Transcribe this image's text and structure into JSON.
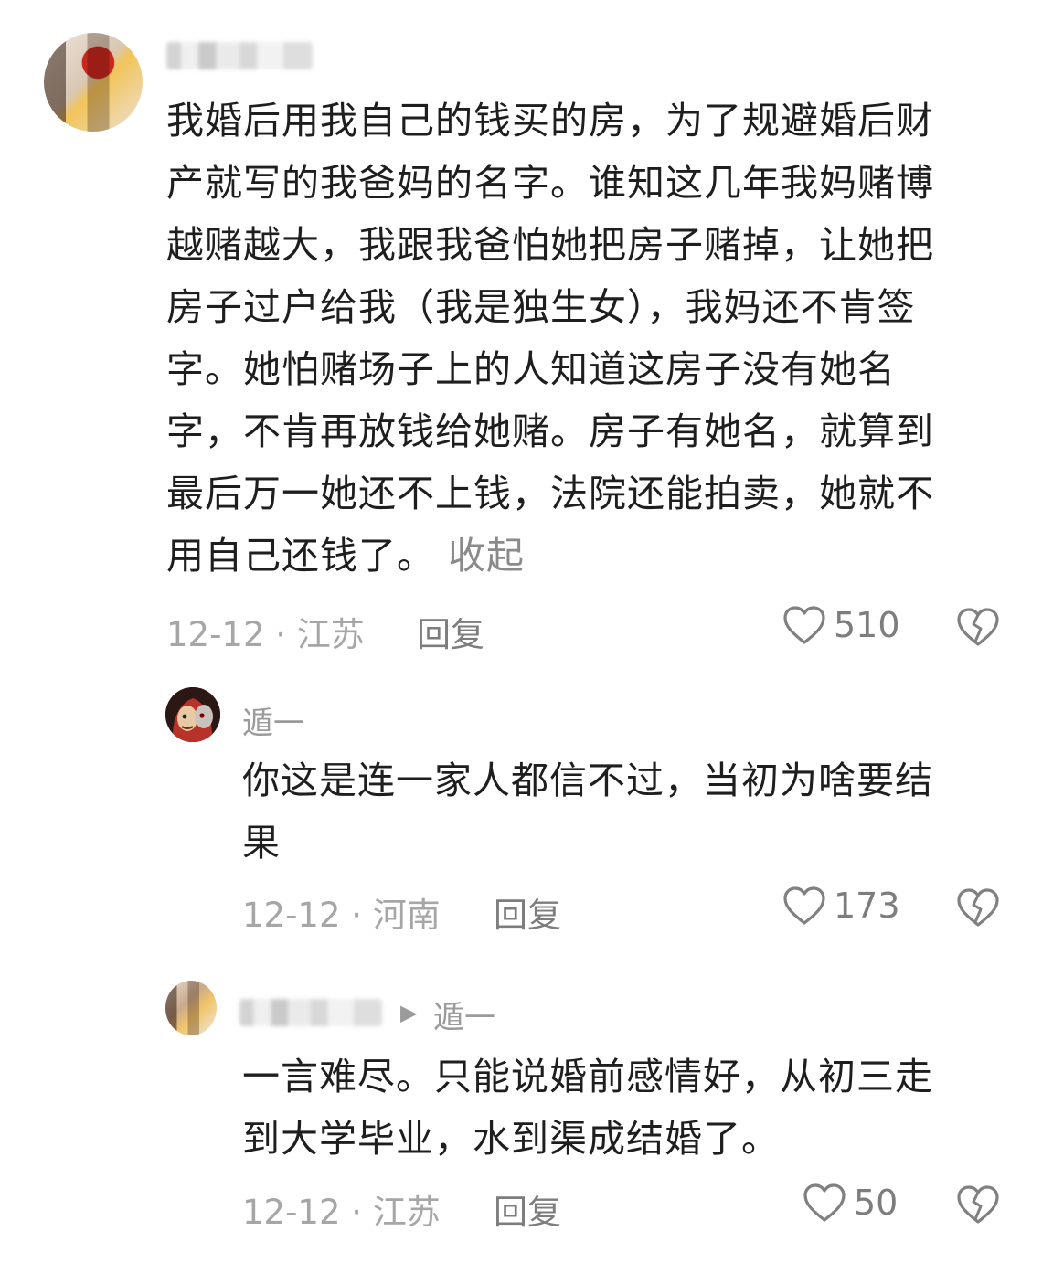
{
  "comment_main": {
    "text": "我婚后用我自己的钱买的房，为了规避婚后财产就写的我爸妈的名字。谁知这几年我妈赌博越赌越大，我跟我爸怕她把房子赌掉，让她把房子过户给我（我是独生女），我妈还不肯签字。她怕赌场子上的人知道这房子没有她名字，不肯再放钱给她赌。房子有她名，就算到最后万一她还不上钱，法院还能拍卖，她就不用自己还钱了。",
    "lines": [
      "我婚后用我自己的钱买的房，为了规避婚后财",
      "产就写的我爸妈的名字。谁知这几年我妈赌博",
      "越赌越大，我跟我爸怕她把房子赌掉，让她把",
      "房子过户给我（我是独生女），我妈还不肯签",
      "字。她怕赌场子上的人知道这房子没有她名",
      "字，不肯再放钱给她赌。房子有她名，就算到",
      "最后万一她还不上钱，法院还能拍卖，她就不",
      "用自己还钱了。"
    ],
    "collapse_label": "收起",
    "date": "12-12",
    "location": "江苏",
    "reply_label": "回复",
    "likes": "510"
  },
  "reply_1": {
    "username": "遁一",
    "lines": [
      "你这是连一家人都信不过，当初为啥要结",
      "果"
    ],
    "date": "12-12",
    "location": "河南",
    "reply_label": "回复",
    "likes": "173"
  },
  "reply_2": {
    "reply_to": "遁一",
    "lines": [
      "一言难尽。只能说婚前感情好，从初三走",
      "到大学毕业，水到渠成结婚了。"
    ],
    "date": "12-12",
    "location": "江苏",
    "reply_label": "回复",
    "likes": "50"
  },
  "separator": "·",
  "icons": {
    "like": "heart-outline-icon",
    "dislike": "broken-heart-icon",
    "reply_arrow": "triangle-right-icon"
  }
}
